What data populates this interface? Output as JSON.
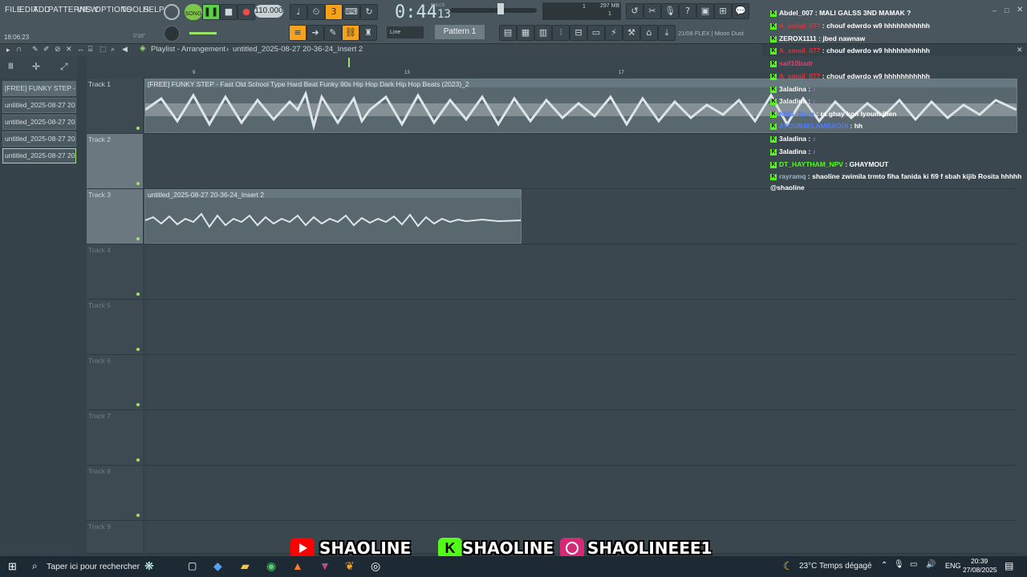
{
  "menu": [
    "FILE",
    "EDIT",
    "ADD",
    "PATTERNS",
    "VIEW",
    "OPTIONS",
    "TOOLS",
    "HELP"
  ],
  "transport": {
    "song_label": "SONG",
    "bpm": "110.000",
    "time": "0:44",
    "time_ms": "13",
    "mcs_label": "M:S:CS",
    "memory": "297 MB",
    "cpu_top": "1",
    "cpu_bottom": "1",
    "pattern": "Pattern 1",
    "snap": "Line",
    "plugin_hint": "21/08  FLEX | Moon Dust"
  },
  "clock_left": "18:06:23",
  "clock_left2": "0'38\"",
  "playlist": {
    "breadcrumb_a": "Playlist - Arrangement",
    "breadcrumb_b": "untitled_2025-08-27 20-36-24_Insert 2"
  },
  "ruler": {
    "marks": [
      "9",
      "13",
      "17"
    ]
  },
  "clips_panel": [
    "[FREE] FUNKY STEP -",
    "untitled_2025-08-27 20-",
    "untitled_2025-08-27 20-",
    "untitled_2025-08-27 20-",
    "untitled_2025-08-27 20-"
  ],
  "tracks": [
    "Track 1",
    "Track 2",
    "Track 3",
    "Track 4",
    "Track 5",
    "Track 6",
    "Track 7",
    "Track 8",
    "Track 9"
  ],
  "clip1_title": "[FREE] FUNKY STEP - Fast Old School Type Hard Beat  Funky 90s Hip Hop Dark Hip Hop Beats (2023)_2",
  "clip3_title": "untitled_2025-08-27 20-36-24_Insert 2",
  "chat": [
    {
      "user": "AYOUB4ELAMRAOUI",
      "msg": "",
      "color": "#4e7cff"
    },
    {
      "user": "Abdel_007",
      "msg": "MALI GALSS 3ND MAMAK ?",
      "color": "#ffffff"
    },
    {
      "user": "A_smail_077",
      "msg": "chouf edwrdo w9 hhhhhhhhhhh",
      "color": "#e0303a"
    },
    {
      "user": "ZEROX1111",
      "msg": "jbed nawnaw",
      "color": "#ffffff"
    },
    {
      "user": "A_smail_077",
      "msg": "chouf edwrdo w9 hhhhhhhhhhh",
      "color": "#e0303a"
    },
    {
      "user": "saif10badr",
      "msg": "",
      "color": "#e0406a"
    },
    {
      "user": "A_smail_077",
      "msg": "chouf edwrdo w9 hhhhhhhhhhh",
      "color": "#e0303a"
    },
    {
      "user": "3aladina",
      "msg": "",
      "color": "#ffffff"
    },
    {
      "user": "3aladina",
      "msg": "",
      "color": "#ffffff"
    },
    {
      "user": "KNG_Marg",
      "msg": "ra ghay kon lyoum lben",
      "color": "#4e7cff"
    },
    {
      "user": "AYOUB4ELAMRAOUI",
      "msg": "hh",
      "color": "#4e7cff"
    },
    {
      "user": "3aladina",
      "msg": "",
      "color": "#ffffff"
    },
    {
      "user": "3aladina",
      "msg": "",
      "color": "#ffffff"
    },
    {
      "user": "DT_HAYTHAM_NPV",
      "msg": "GHAYMOUT",
      "color": "#53fc18"
    },
    {
      "user": "rayramq",
      "msg": "shaoline zwimila trmto fiha fanida ki fi9 f sbah kijib Rosita hhhhh",
      "color": "#9fb3c8"
    }
  ],
  "chat_tail": "@shaoline",
  "banner": {
    "youtube": "SHAOLINE",
    "kick": "SHAOLINE",
    "instagram": "SHAOLINEEE1",
    "colors": {
      "youtube": "#ff0000",
      "kick": "#53fc18",
      "instagram": "#d62976"
    }
  },
  "taskbar": {
    "search": "Taper ici pour rechercher",
    "weather": "23°C  Temps dégagé",
    "lang": "ENG",
    "time": "20:39",
    "date": "27/08/2025"
  }
}
